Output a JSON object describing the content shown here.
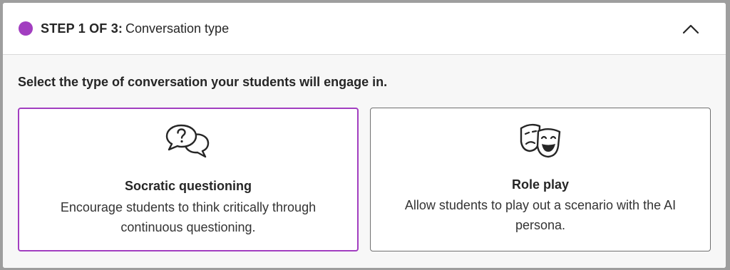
{
  "header": {
    "step_label": "STEP 1 OF 3:",
    "step_title": "Conversation type",
    "step_color": "#a23ec0",
    "collapse_icon": "chevron-up-icon"
  },
  "main": {
    "prompt": "Select the type of conversation your students will engage in.",
    "options": [
      {
        "icon": "speech-bubbles-question-icon",
        "title": "Socratic questioning",
        "description": "Encourage students to think critically through continuous questioning.",
        "selected": true
      },
      {
        "icon": "theater-masks-icon",
        "title": "Role play",
        "description": "Allow students to play out a scenario with the AI persona.",
        "selected": false
      }
    ]
  },
  "colors": {
    "accent": "#a23ec0",
    "card_border": "#6f6f6f",
    "body_background": "#f7f7f7"
  }
}
